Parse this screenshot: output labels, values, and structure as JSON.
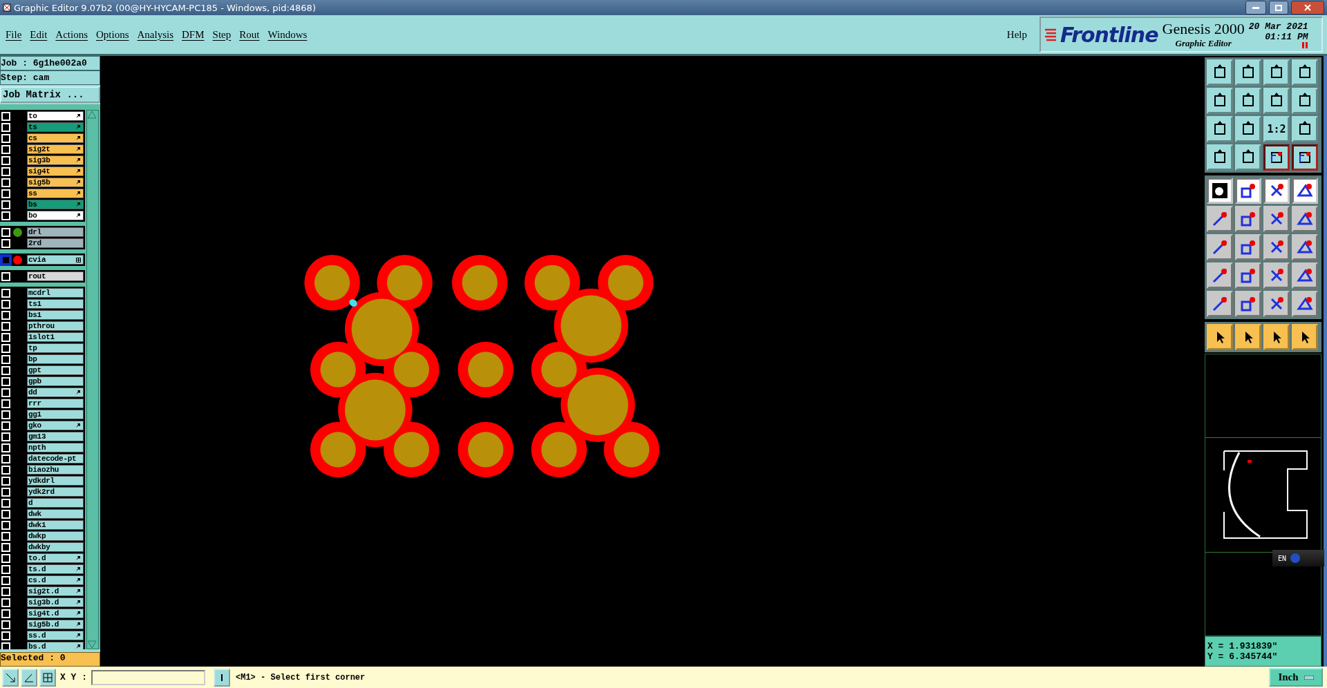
{
  "window": {
    "title": "Graphic Editor 9.07b2 (00@HY-HYCAM-PC185 - Windows, pid:4868)"
  },
  "menu": [
    "File",
    "Edit",
    "Actions",
    "Options",
    "Analysis",
    "DFM",
    "Step",
    "Rout",
    "Windows"
  ],
  "help": "Help",
  "logo": {
    "brand": "Frontline",
    "product": "Genesis 2000",
    "subtitle": "Graphic Editor",
    "date": "20 Mar 2021",
    "time": "01:11 PM"
  },
  "job": {
    "job": "Job : 6g1he002a0",
    "step": "Step: cam",
    "matrix_button": "Job Matrix ..."
  },
  "layer_groups": [
    {
      "layers": [
        {
          "name": "to",
          "color": "#ffffff",
          "pointer": true,
          "active": false
        },
        {
          "name": "ts",
          "color": "#169c78",
          "pointer": true,
          "active": false
        },
        {
          "name": "cs",
          "color": "#f8c050",
          "pointer": true,
          "active": false
        },
        {
          "name": "sig2t",
          "color": "#f8c050",
          "pointer": true,
          "active": false
        },
        {
          "name": "sig3b",
          "color": "#f8c050",
          "pointer": true,
          "active": false
        },
        {
          "name": "sig4t",
          "color": "#f8c050",
          "pointer": true,
          "active": false
        },
        {
          "name": "sig5b",
          "color": "#f8c050",
          "pointer": true,
          "active": false
        },
        {
          "name": "ss",
          "color": "#f8c050",
          "pointer": true,
          "active": false
        },
        {
          "name": "bs",
          "color": "#169c78",
          "pointer": true,
          "active": false
        },
        {
          "name": "bo",
          "color": "#ffffff",
          "pointer": true,
          "active": false
        }
      ]
    },
    {
      "layers": [
        {
          "name": "drl",
          "color": "#a0b4bc",
          "dot": {
            "color": "#3c9a10"
          },
          "pointer": false,
          "active": false
        },
        {
          "name": "2rd",
          "color": "#a0b4bc",
          "pointer": false,
          "active": false
        }
      ]
    },
    {
      "layers": [
        {
          "name": "cvia",
          "color": "#9edcdc",
          "dot": {
            "color": "#ff0000"
          },
          "pointer": false,
          "expandable": true,
          "active": true
        }
      ]
    },
    {
      "layers": [
        {
          "name": "rout",
          "color": "#d8d8d8",
          "pointer": false,
          "active": false
        }
      ]
    },
    {
      "layers": [
        {
          "name": "mcdrl",
          "color": "#9edcdc",
          "pointer": false,
          "active": false
        },
        {
          "name": "ts1",
          "color": "#9edcdc",
          "pointer": false,
          "active": false
        },
        {
          "name": "bs1",
          "color": "#9edcdc",
          "pointer": false,
          "active": false
        },
        {
          "name": "pthrou",
          "color": "#9edcdc",
          "pointer": false,
          "active": false
        },
        {
          "name": "1slot1",
          "color": "#9edcdc",
          "pointer": false,
          "active": false
        },
        {
          "name": "tp",
          "color": "#9edcdc",
          "pointer": false,
          "active": false
        },
        {
          "name": "bp",
          "color": "#9edcdc",
          "pointer": false,
          "active": false
        },
        {
          "name": "gpt",
          "color": "#9edcdc",
          "pointer": false,
          "active": false
        },
        {
          "name": "gpb",
          "color": "#9edcdc",
          "pointer": false,
          "active": false
        },
        {
          "name": "dd",
          "color": "#9edcdc",
          "pointer": true,
          "active": false
        },
        {
          "name": "rrr",
          "color": "#9edcdc",
          "pointer": false,
          "active": false
        },
        {
          "name": "gg1",
          "color": "#9edcdc",
          "pointer": false,
          "active": false
        },
        {
          "name": "gko",
          "color": "#9edcdc",
          "pointer": true,
          "active": false
        },
        {
          "name": "gm13",
          "color": "#9edcdc",
          "pointer": false,
          "active": false
        },
        {
          "name": "npth",
          "color": "#9edcdc",
          "pointer": false,
          "active": false
        },
        {
          "name": "datecode-pt",
          "color": "#9edcdc",
          "pointer": false,
          "active": false
        },
        {
          "name": "biaozhu",
          "color": "#9edcdc",
          "pointer": false,
          "active": false
        },
        {
          "name": "ydkdrl",
          "color": "#9edcdc",
          "pointer": false,
          "active": false
        },
        {
          "name": "ydk2rd",
          "color": "#9edcdc",
          "pointer": false,
          "active": false
        },
        {
          "name": "d",
          "color": "#9edcdc",
          "pointer": false,
          "active": false
        },
        {
          "name": "dwk",
          "color": "#9edcdc",
          "pointer": false,
          "active": false
        },
        {
          "name": "dwk1",
          "color": "#9edcdc",
          "pointer": false,
          "active": false
        },
        {
          "name": "dwkp",
          "color": "#9edcdc",
          "pointer": false,
          "active": false
        },
        {
          "name": "dwkby",
          "color": "#9edcdc",
          "pointer": false,
          "active": false
        },
        {
          "name": "to.d",
          "color": "#9edcdc",
          "pointer": true,
          "active": false
        },
        {
          "name": "ts.d",
          "color": "#9edcdc",
          "pointer": true,
          "active": false
        },
        {
          "name": "cs.d",
          "color": "#9edcdc",
          "pointer": true,
          "active": false
        },
        {
          "name": "sig2t.d",
          "color": "#9edcdc",
          "pointer": true,
          "active": false
        },
        {
          "name": "sig3b.d",
          "color": "#9edcdc",
          "pointer": true,
          "active": false
        },
        {
          "name": "sig4t.d",
          "color": "#9edcdc",
          "pointer": true,
          "active": false
        },
        {
          "name": "sig5b.d",
          "color": "#9edcdc",
          "pointer": true,
          "active": false
        },
        {
          "name": "ss.d",
          "color": "#9edcdc",
          "pointer": true,
          "active": false
        },
        {
          "name": "bs.d",
          "color": "#9edcdc",
          "pointer": true,
          "active": false
        }
      ]
    }
  ],
  "selected_count": "Selected : 0",
  "toolbar_rows": [
    {
      "kind": "view",
      "buttons": [
        {
          "on": false
        },
        {
          "on": false
        },
        {
          "on": false
        },
        {
          "on": false
        }
      ]
    },
    {
      "kind": "view",
      "buttons": [
        {
          "on": false
        },
        {
          "on": false
        },
        {
          "on": false
        },
        {
          "on": false
        }
      ]
    },
    {
      "kind": "view",
      "buttons": [
        {
          "on": false
        },
        {
          "on": false
        },
        {
          "label": "1:2",
          "on": false
        },
        {
          "on": false
        }
      ]
    },
    {
      "kind": "view",
      "buttons": [
        {
          "on": false
        },
        {
          "on": false
        },
        {
          "on": true
        },
        {
          "on": true
        }
      ]
    },
    {
      "kind": "edit",
      "buttons": [
        {
          "on": true
        },
        {
          "on": true
        },
        {
          "on": true
        },
        {
          "on": true
        }
      ]
    },
    {
      "kind": "edit",
      "buttons": [
        {
          "on": false
        },
        {
          "on": false
        },
        {
          "on": false
        },
        {
          "on": false
        }
      ]
    },
    {
      "kind": "edit",
      "buttons": [
        {
          "on": false
        },
        {
          "on": false
        },
        {
          "on": false
        },
        {
          "on": false
        }
      ]
    },
    {
      "kind": "edit",
      "buttons": [
        {
          "on": false
        },
        {
          "on": false
        },
        {
          "on": false
        },
        {
          "on": false
        }
      ]
    },
    {
      "kind": "edit",
      "buttons": [
        {
          "on": false
        },
        {
          "on": false
        },
        {
          "on": false
        },
        {
          "on": false
        }
      ]
    },
    {
      "kind": "select",
      "buttons": [
        {
          "on": false
        },
        {
          "on": false
        },
        {
          "on": false
        },
        {
          "on": false
        }
      ]
    }
  ],
  "language_bar": "EN",
  "coordinates": {
    "x": "X = 1.931839\"",
    "y": "Y = 6.345744\""
  },
  "status_bar": {
    "xy_label": "X Y :",
    "message": "<M1> - Select first corner",
    "units": "Inch"
  }
}
